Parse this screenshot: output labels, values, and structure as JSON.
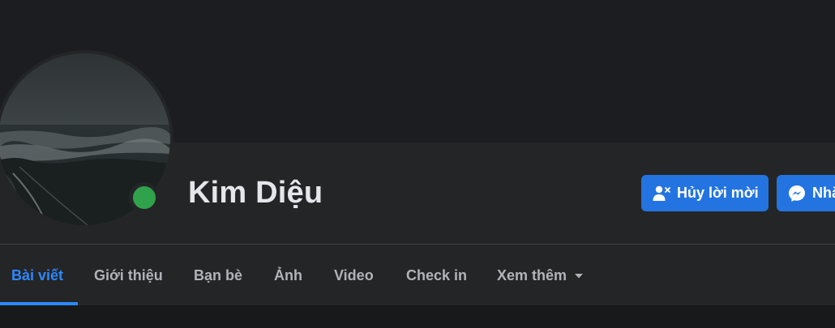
{
  "profile": {
    "name": "Kim Diệu",
    "online": true
  },
  "actions": {
    "cancel_request_label": "Hủy lời mời",
    "message_label": "Nhắn tin"
  },
  "tabs": [
    {
      "label": "Bài viết",
      "active": true
    },
    {
      "label": "Giới thiệu"
    },
    {
      "label": "Bạn bè"
    },
    {
      "label": "Ảnh"
    },
    {
      "label": "Video"
    },
    {
      "label": "Check in"
    },
    {
      "label": "Xem thêm"
    }
  ],
  "colors": {
    "accent": "#2d88ff",
    "button": "#2374e1",
    "online": "#31a24c",
    "surface": "#242526",
    "background": "#18191a"
  },
  "icons": {
    "cancel_request": "person-remove-icon",
    "message": "messenger-icon",
    "more": "caret-down-icon"
  }
}
